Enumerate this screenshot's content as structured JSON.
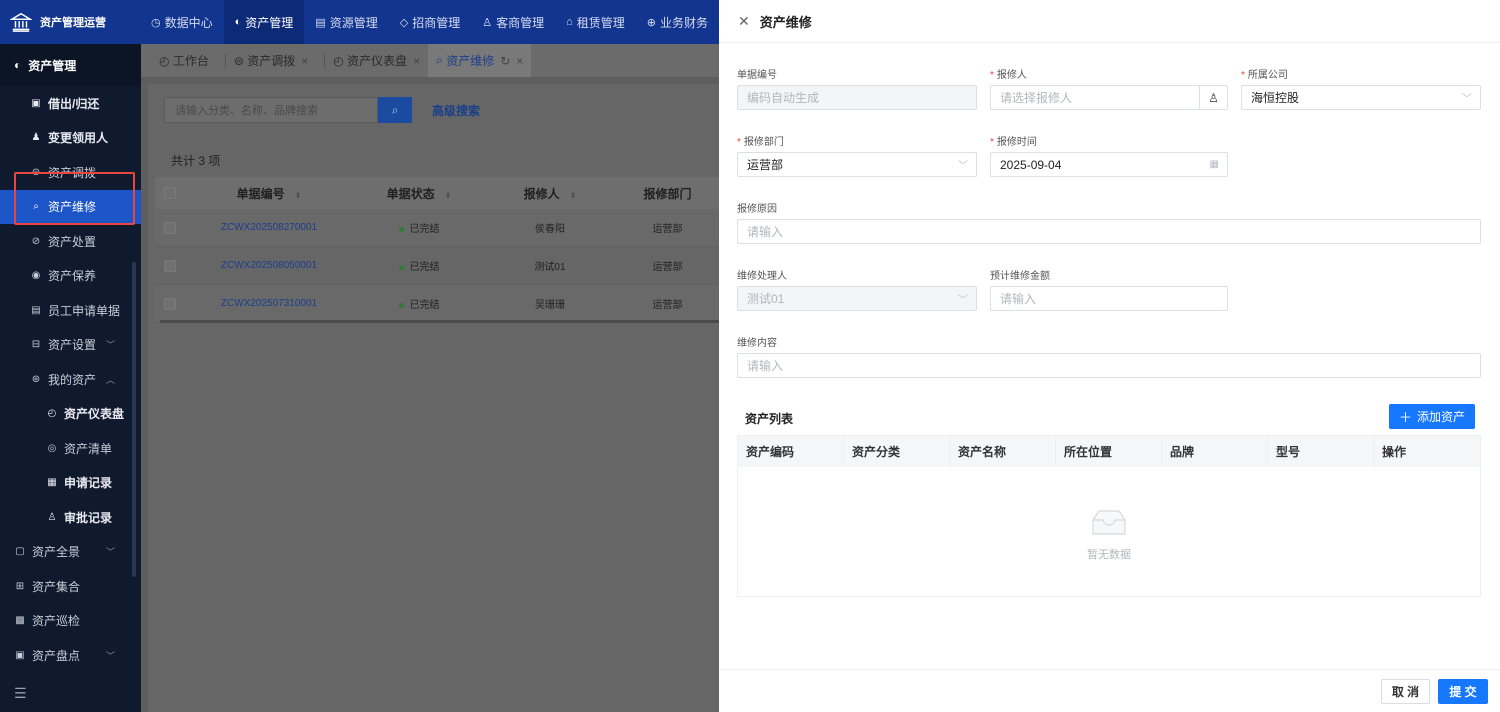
{
  "app": {
    "title": "资产管理运营"
  },
  "topnav": [
    {
      "label": "数据中心",
      "icon": "◷"
    },
    {
      "label": "资产管理",
      "icon": "◐"
    },
    {
      "label": "资源管理",
      "icon": "▤"
    },
    {
      "label": "招商管理",
      "icon": "◇"
    },
    {
      "label": "客商管理",
      "icon": "♙"
    },
    {
      "label": "租赁管理",
      "icon": "⌂"
    },
    {
      "label": "业务财务",
      "icon": "⊕"
    }
  ],
  "sidebar": {
    "header": "资产管理",
    "items": [
      {
        "label": "借出/归还",
        "icon": "▣"
      },
      {
        "label": "变更领用人",
        "icon": "♟"
      },
      {
        "label": "资产调拨",
        "icon": "⊜"
      },
      {
        "label": "资产维修",
        "icon": "⌕"
      },
      {
        "label": "资产处置",
        "icon": "⊘"
      },
      {
        "label": "资产保养",
        "icon": "◉"
      },
      {
        "label": "员工申请单据",
        "icon": "▤"
      },
      {
        "label": "资产设置",
        "icon": "⊟"
      },
      {
        "label": "我的资产",
        "icon": "⊛"
      },
      {
        "label": "资产仪表盘",
        "icon": "◴"
      },
      {
        "label": "资产清单",
        "icon": "◎"
      },
      {
        "label": "申请记录",
        "icon": "▦"
      },
      {
        "label": "审批记录",
        "icon": "♙"
      },
      {
        "label": "资产全景",
        "icon": "▢"
      },
      {
        "label": "资产集合",
        "icon": "⊞"
      },
      {
        "label": "资产巡检",
        "icon": "▩"
      },
      {
        "label": "资产盘点",
        "icon": "▣"
      }
    ],
    "menu_icon": "☰"
  },
  "tabs": [
    {
      "label": "工作台",
      "icon": "◴"
    },
    {
      "label": "资产调拨",
      "icon": "⊜"
    },
    {
      "label": "资产仪表盘",
      "icon": "◴"
    },
    {
      "label": "资产维修",
      "icon": "⌕"
    }
  ],
  "list": {
    "search_placeholder": "请输入分类、名称、品牌搜索",
    "advanced_search": "高级搜索",
    "total": "共计 3 项",
    "columns": [
      "单据编号",
      "单据状态",
      "报修人",
      "报修部门"
    ],
    "rows": [
      {
        "code": "ZCWX202508270001",
        "status": "已完结",
        "reporter": "侯春阳",
        "dept": "运营部"
      },
      {
        "code": "ZCWX202508050001",
        "status": "已完结",
        "reporter": "测试01",
        "dept": "运营部"
      },
      {
        "code": "ZCWX202507310001",
        "status": "已完结",
        "reporter": "吴珊珊",
        "dept": "运营部"
      }
    ]
  },
  "drawer": {
    "title": "资产维修",
    "form": {
      "doc_no": {
        "label": "单据编号",
        "placeholder": "编码自动生成"
      },
      "reporter": {
        "label": "报修人",
        "placeholder": "请选择报修人"
      },
      "company": {
        "label": "所属公司",
        "value": "海恒控股"
      },
      "dept": {
        "label": "报修部门",
        "value": "运营部"
      },
      "time": {
        "label": "报修时间",
        "value": "2025-09-04"
      },
      "reason": {
        "label": "报修原因",
        "placeholder": "请输入"
      },
      "handler": {
        "label": "维修处理人",
        "value": "测试01"
      },
      "amount": {
        "label": "预计维修金额",
        "placeholder": "请输入"
      },
      "content": {
        "label": "维修内容",
        "placeholder": "请输入"
      }
    },
    "asset_list": {
      "title": "资产列表",
      "add_label": "添加资产",
      "columns": [
        "资产编码",
        "资产分类",
        "资产名称",
        "所在位置",
        "品牌",
        "型号",
        "操作"
      ],
      "empty_text": "暂无数据"
    },
    "footer": {
      "cancel": "取 消",
      "submit": "提 交"
    }
  }
}
